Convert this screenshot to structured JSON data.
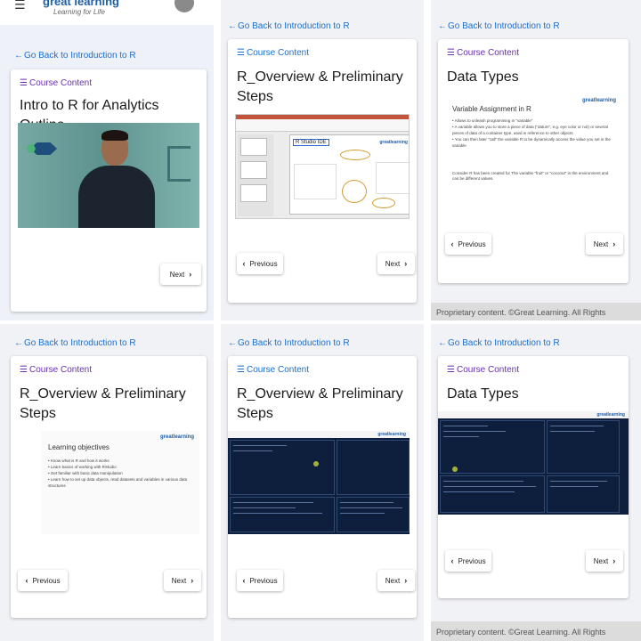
{
  "app": {
    "brand_name": "great learning",
    "brand_tagline": "Learning for Life"
  },
  "back_link": "Go Back to Introduction to R",
  "course_content_label": "Course Content",
  "icons": {
    "back": "←",
    "course_content": "☰",
    "prev": "‹",
    "next": "›",
    "menu": "☰"
  },
  "buttons": {
    "previous": "Previous",
    "next": "Next"
  },
  "cards": {
    "intro": {
      "title": "Intro to R for Analytics Outline"
    },
    "overview": {
      "title": "R_Overview & Preliminary Steps"
    },
    "datatypes": {
      "title": "Data Types"
    }
  },
  "footer": {
    "text": "Proprietary content. ©Great Learning. All Rights"
  },
  "slides": {
    "rstudio_label": "R Studio IDE",
    "logo": "greatlearning",
    "variable": {
      "title": "Variable Assignment in R",
      "bullets": [
        "Allows to unleash programming in \"variable\"",
        "A variable allows you to store a piece of data (\"datum\", e.g. eye color or not) or several pieces of data of a container type, used in reference to other objects",
        "You can then later \"call\" the variable R to be dynamically access the value you set in the variable"
      ],
      "note": "Consider R has been created for The variable \"fruit\" or \"coconut\" in the environment and can be different values."
    },
    "objectives": {
      "title": "Learning objectives",
      "bullets": [
        "Know what is R and how it works",
        "Learn basics of working with RStudio",
        "Get familiar with basic data manipulation",
        "Learn how to set up data objects, read datasets and variables in various data structures"
      ]
    }
  },
  "colors": {
    "link_blue": "#1a6fcf",
    "course_content_purple": "#6b2fb3",
    "panel_bg": "#f1f2f6"
  }
}
